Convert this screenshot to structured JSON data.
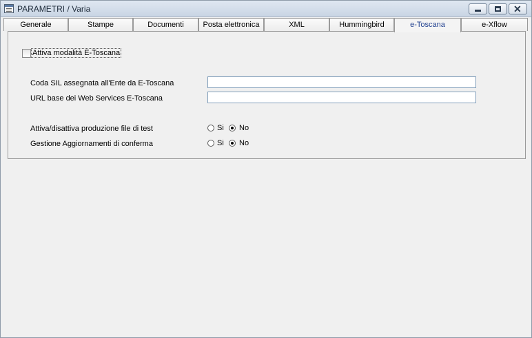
{
  "window": {
    "title": "PARAMETRI / Varia",
    "icon": "form-window-icon"
  },
  "tabs": [
    {
      "label": "Generale",
      "active": false
    },
    {
      "label": "Stampe",
      "active": false
    },
    {
      "label": "Documenti",
      "active": false
    },
    {
      "label": "Posta elettronica",
      "active": false
    },
    {
      "label": "XML",
      "active": false
    },
    {
      "label": "Hummingbird",
      "active": false
    },
    {
      "label": "e-Toscana",
      "active": true
    },
    {
      "label": "e-Xflow",
      "active": false
    }
  ],
  "form": {
    "enable_checkbox": {
      "label": "Attiva modalità E-Toscana",
      "checked": false
    },
    "coda_sil": {
      "label": "Coda SIL assegnata all'Ente da E-Toscana",
      "value": ""
    },
    "url_base": {
      "label": "URL base dei Web Services E-Toscana",
      "value": ""
    },
    "test_production": {
      "label": "Attiva/disattiva produzione file di test",
      "options": [
        "Si",
        "No"
      ],
      "selected": "No"
    },
    "confirm_updates": {
      "label": "Gestione Aggiornamenti di conferma",
      "options": [
        "Si",
        "No"
      ],
      "selected": "No"
    }
  },
  "colors": {
    "active_tab_text": "#1f3f8f",
    "field_border": "#7f9db9",
    "window_bg": "#f0f0f0"
  }
}
